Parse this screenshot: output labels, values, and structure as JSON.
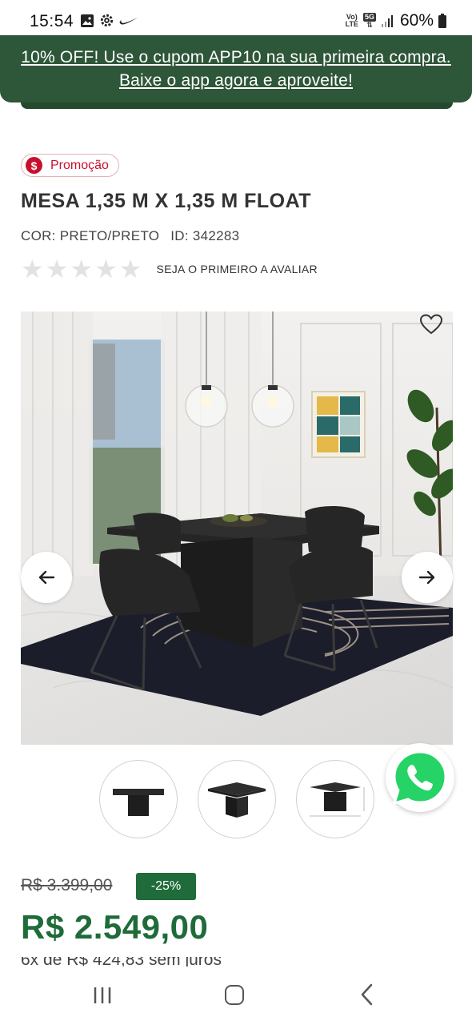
{
  "status_bar": {
    "time": "15:54",
    "battery": "60%",
    "network_top": "Vo)",
    "network_bottom": "LTE",
    "signal_badge": "5G",
    "icons": [
      "gallery-icon",
      "settings-icon",
      "nike-icon",
      "volte-icon",
      "5g-icon",
      "signal-icon",
      "battery-icon"
    ]
  },
  "banner": {
    "text": "10% OFF! Use o cupom APP10 na sua primeira compra. Baixe o app agora e aproveite!"
  },
  "product": {
    "badge_symbol": "$",
    "badge": "Promoção",
    "title": "MESA 1,35 M X 1,35 M FLOAT",
    "color": "COR: PRETO/PRETO",
    "id": "ID: 342283",
    "rating_label": "SEJA O PRIMEIRO A AVALIAR",
    "rating_stars_filled": 0,
    "rating_stars_total": 5
  },
  "gallery": {
    "favorite_icon": "heart-icon",
    "prev_icon": "arrow-left-icon",
    "next_icon": "arrow-right-icon",
    "thumbnails": 3
  },
  "price": {
    "old": "R$ 3.399,00",
    "discount": "-25%",
    "current": "R$ 2.549,00",
    "installment": "6x de R$ 424,83 sem juros"
  },
  "colors": {
    "brand_green": "#2e5638",
    "price_green": "#1f6b3a",
    "promo_red": "#c8102e",
    "whatsapp_green": "#25d366"
  }
}
